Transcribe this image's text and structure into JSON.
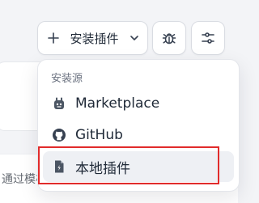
{
  "toolbar": {
    "install_button_label": "安装插件",
    "install_button_icon": "plus-icon",
    "install_button_chevron": "chevron-down-icon",
    "debug_button_icon": "bug-icon",
    "settings_button_icon": "sliders-icon"
  },
  "install_menu": {
    "heading": "安装源",
    "items": [
      {
        "label": "Marketplace",
        "icon": "marketplace-icon"
      },
      {
        "label": "GitHub",
        "icon": "github-icon"
      },
      {
        "label": "本地插件",
        "icon": "local-file-icon"
      }
    ]
  },
  "background": {
    "row_text": "通过模板"
  },
  "colors": {
    "accent_highlight": "#e12b2b",
    "text_primary": "#1f2937",
    "text_secondary": "#6b7280"
  }
}
